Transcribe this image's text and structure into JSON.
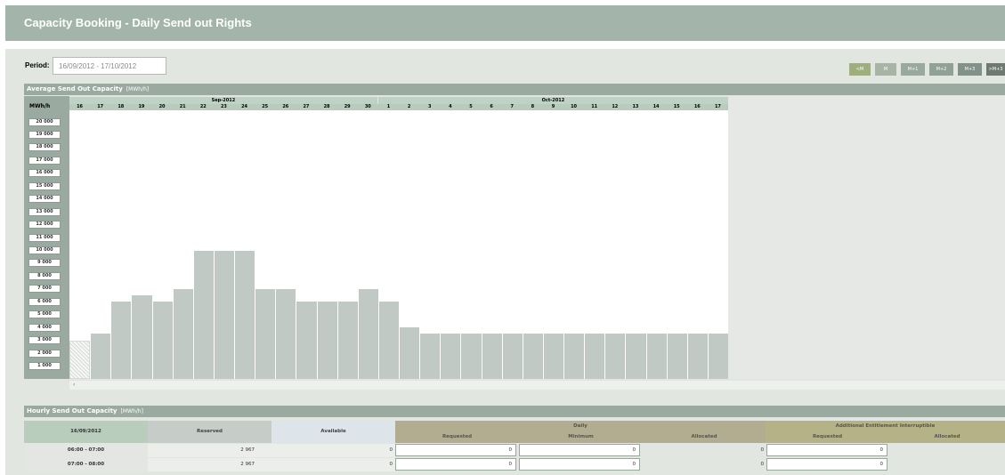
{
  "page_title": "Capacity Booking - Daily Send out Rights",
  "period": {
    "label": "Period:",
    "value": "16/09/2012 - 17/10/2012"
  },
  "month_buttons": [
    {
      "label": "<M",
      "color": "#9fae7d"
    },
    {
      "label": "M",
      "color": "#a8b5a6"
    },
    {
      "label": "M+1",
      "color": "#9aa99e"
    },
    {
      "label": "M+2",
      "color": "#91a196"
    },
    {
      "label": "M+3",
      "color": "#82918a"
    },
    {
      "label": ">M+3",
      "color": "#6d7972"
    }
  ],
  "chart_section": {
    "title": "Average Send Out Capacity",
    "unit": "[MWh/h]",
    "axis_label": "MWh/h"
  },
  "chart_data": {
    "type": "bar",
    "months": [
      {
        "label": "Sep-2012",
        "days": 15
      },
      {
        "label": "Oct-2012",
        "days": 17
      }
    ],
    "categories": [
      "16",
      "17",
      "18",
      "19",
      "20",
      "21",
      "22",
      "23",
      "24",
      "25",
      "26",
      "27",
      "28",
      "29",
      "30",
      "1",
      "2",
      "3",
      "4",
      "5",
      "6",
      "7",
      "8",
      "9",
      "10",
      "11",
      "12",
      "13",
      "14",
      "15",
      "16",
      "17"
    ],
    "values": [
      3000,
      3500,
      6000,
      6500,
      6000,
      7000,
      10000,
      10000,
      10000,
      7000,
      7000,
      6000,
      6000,
      6000,
      7000,
      6000,
      4000,
      3500,
      3500,
      3500,
      3500,
      3500,
      3500,
      3500,
      3500,
      3500,
      3500,
      3500,
      3500,
      3500,
      3500,
      3500
    ],
    "hatched_first": true,
    "yticks": [
      "20 000",
      "19 000",
      "18 000",
      "17 000",
      "16 000",
      "15 000",
      "14 000",
      "13 000",
      "12 000",
      "11 000",
      "10 000",
      "9 000",
      "8 000",
      "7 000",
      "6 000",
      "5 000",
      "4 000",
      "3 000",
      "2 000",
      "1 000"
    ],
    "ylim": [
      0,
      21000
    ]
  },
  "hourly_section": {
    "title": "Hourly Send Out Capacity",
    "unit": "[MWh/h]"
  },
  "hourly_table": {
    "date": "16/09/2012",
    "reserved_label": "Reserved",
    "available_label": "Available",
    "daily_label": "Daily",
    "requested_label": "Requested",
    "minimum_label": "Minimum",
    "allocated_label": "Allocated",
    "additional_label": "Additional Entitlement Interruptible",
    "add_requested_label": "Requested",
    "add_allocated_label": "Allocated",
    "rows": [
      {
        "time": "06:00 - 07:00",
        "reserved": "2 967",
        "available": "0",
        "requested": "0",
        "minimum": "0",
        "allocated": "0",
        "add_requested": "0"
      },
      {
        "time": "07:00 - 08:00",
        "reserved": "2 967",
        "available": "0",
        "requested": "0",
        "minimum": "0",
        "allocated": "0",
        "add_requested": "0"
      }
    ]
  }
}
